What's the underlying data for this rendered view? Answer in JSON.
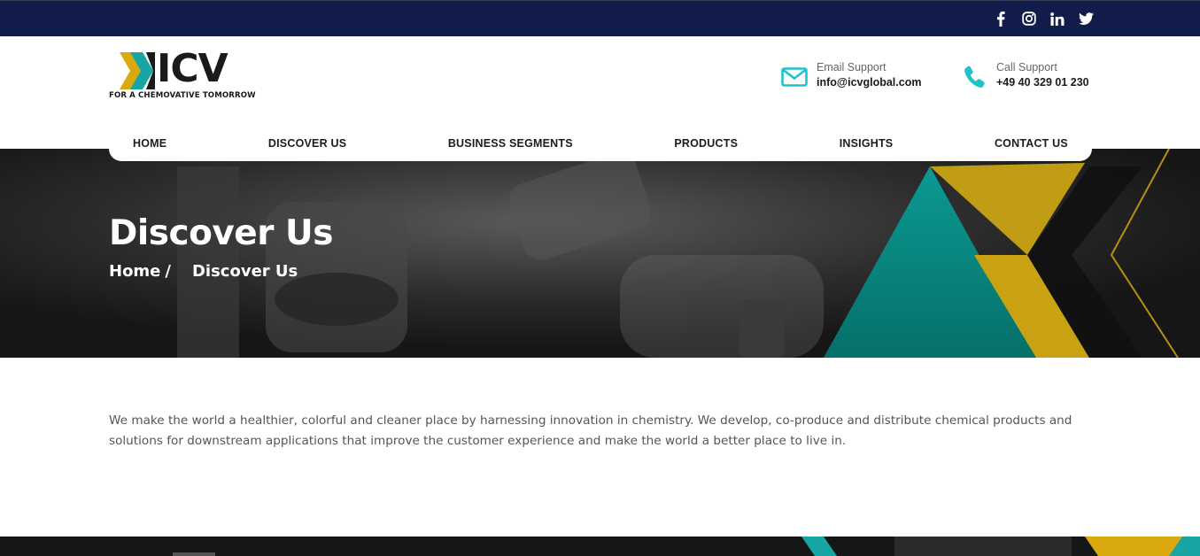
{
  "social": {
    "icons": [
      "facebook-icon",
      "instagram-icon",
      "linkedin-icon",
      "twitter-icon"
    ]
  },
  "brand": {
    "name": "ICV",
    "tagline": "FOR A CHEMOVATIVE TOMORROW"
  },
  "contact": {
    "email": {
      "label": "Email Support",
      "value": "info@icvglobal.com",
      "icon": "mail-icon"
    },
    "phone": {
      "label": "Call Support",
      "value": "+49 40 329 01 230",
      "icon": "phone-icon"
    }
  },
  "nav": {
    "items": [
      "HOME",
      "DISCOVER US",
      "BUSINESS SEGMENTS",
      "PRODUCTS",
      "INSIGHTS",
      "CONTACT US"
    ]
  },
  "hero": {
    "title": "Discover Us",
    "breadcrumb": {
      "home": "Home",
      "separator": "/",
      "current": "Discover Us"
    }
  },
  "intro": {
    "text": "We make the world a healthier, colorful and cleaner place by harnessing innovation in chemistry. We develop, co-produce and distribute chemical products and solutions for downstream applications that improve the customer experience and make the world a better place to live in."
  },
  "colors": {
    "topbar": "#121c4a",
    "accent_teal": "#17a6a4",
    "accent_gold": "#d9a90f",
    "icon_cyan": "#1fc2cc"
  }
}
